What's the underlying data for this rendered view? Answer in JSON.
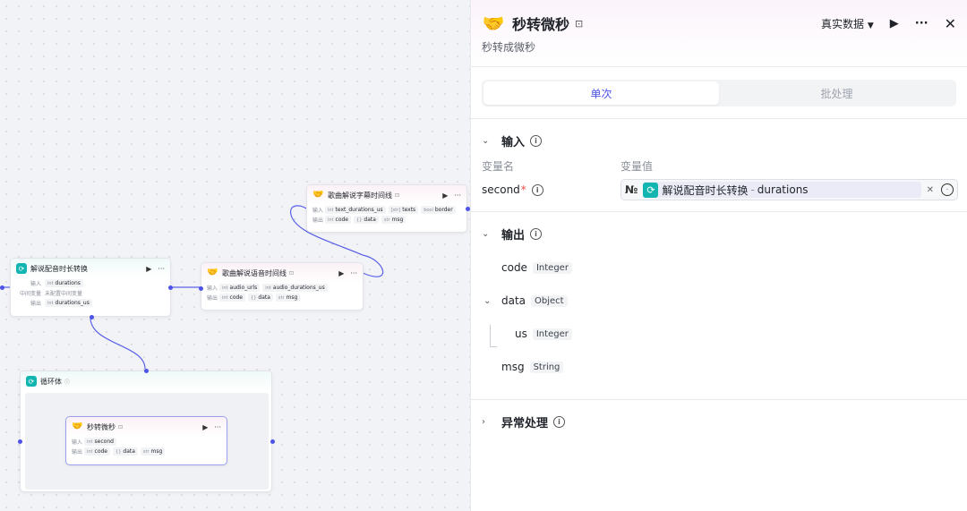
{
  "canvas": {
    "node_durations": {
      "title": "解说配音时长转换",
      "in_label": "输入",
      "in_tag_type": "int",
      "in_tag": "durations",
      "mid_label": "中间变量",
      "mid_text": "未配置中间变量",
      "out_label": "输出",
      "out_tag_type": "int",
      "out_tag": "durations_us"
    },
    "node_audio": {
      "title": "歌曲解说语音时间线",
      "in_label": "输入",
      "in_tag1_type": "int",
      "in_tag1": "audio_urls",
      "in_tag2_type": "int",
      "in_tag2": "audio_durations_us",
      "out_label": "输出",
      "out_tag1_type": "int",
      "out_tag1": "code",
      "out_tag2_type": "{}",
      "out_tag2": "data",
      "out_tag3_type": "str",
      "out_tag3": "msg"
    },
    "node_subtitle": {
      "title": "歌曲解说字幕时间线",
      "in_label": "输入",
      "in_tag1_type": "int",
      "in_tag1": "text_durations_us",
      "in_tag2_type": "[str]",
      "in_tag2": "texts",
      "in_tag3_type": "bool",
      "in_tag3": "border",
      "out_label": "输出",
      "out_tag1_type": "int",
      "out_tag1": "code",
      "out_tag2_type": "{}",
      "out_tag2": "data",
      "out_tag3_type": "str",
      "out_tag3": "msg"
    },
    "node_loop": {
      "title": "循环体"
    },
    "node_sec": {
      "title": "秒转微秒",
      "in_label": "输入",
      "in_tag_type": "int",
      "in_tag": "second",
      "out_label": "输出",
      "out_tag1_type": "int",
      "out_tag1": "code",
      "out_tag2_type": "{}",
      "out_tag2": "data",
      "out_tag3_type": "str",
      "out_tag3": "msg"
    }
  },
  "panel": {
    "title": "秒转微秒",
    "description": "秒转成微秒",
    "data_mode": "真实数据",
    "tabs": [
      "单次",
      "批处理"
    ],
    "input": {
      "heading": "输入",
      "col_name": "变量名",
      "col_value": "变量值",
      "var_name": "second",
      "required_mark": "*",
      "type_glyph": "№",
      "ref_node": "解说配音时长转换",
      "ref_sep": "-",
      "ref_field": "durations"
    },
    "output": {
      "heading": "输出",
      "fields": [
        {
          "name": "code",
          "type": "Integer"
        },
        {
          "name": "data",
          "type": "Object"
        },
        {
          "name": "us",
          "type": "Integer"
        },
        {
          "name": "msg",
          "type": "String"
        }
      ]
    },
    "error": {
      "heading": "异常处理"
    }
  },
  "colors": {
    "accent": "#4d53e8",
    "teal": "#13b5b1",
    "required": "#f54a45"
  }
}
